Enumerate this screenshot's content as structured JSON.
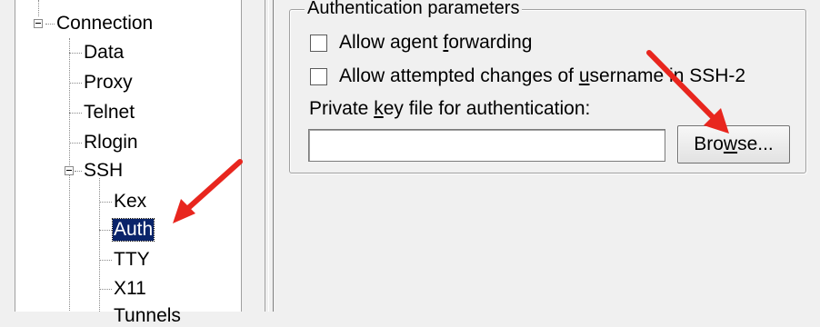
{
  "tree": {
    "connection": "Connection",
    "data": "Data",
    "proxy": "Proxy",
    "telnet": "Telnet",
    "rlogin": "Rlogin",
    "ssh": "SSH",
    "kex": "Kex",
    "auth": "Auth",
    "tty": "TTY",
    "x11": "X11",
    "tunnels_partial": "Tunnels"
  },
  "auth_panel": {
    "group_title": "Authentication parameters",
    "agent_forwarding_label_pre": "Allow agent ",
    "agent_forwarding_label_ul": "f",
    "agent_forwarding_label_post": "orwarding",
    "agent_forwarding_checked": false,
    "username_changes_label_pre": "Allow attempted changes of ",
    "username_changes_label_ul": "u",
    "username_changes_label_post": "sername in SSH-2",
    "username_changes_checked": false,
    "key_file_label_pre": "Private ",
    "key_file_label_ul": "k",
    "key_file_label_post": "ey file for authentication:",
    "key_file_value": "",
    "browse_pre": "Bro",
    "browse_ul": "w",
    "browse_post": "se..."
  },
  "colors": {
    "selection": "#0a246a",
    "annotation_arrow": "#e8261e"
  },
  "icons": [
    "tree-expander-minus-icon",
    "annotation-arrow-icon"
  ]
}
